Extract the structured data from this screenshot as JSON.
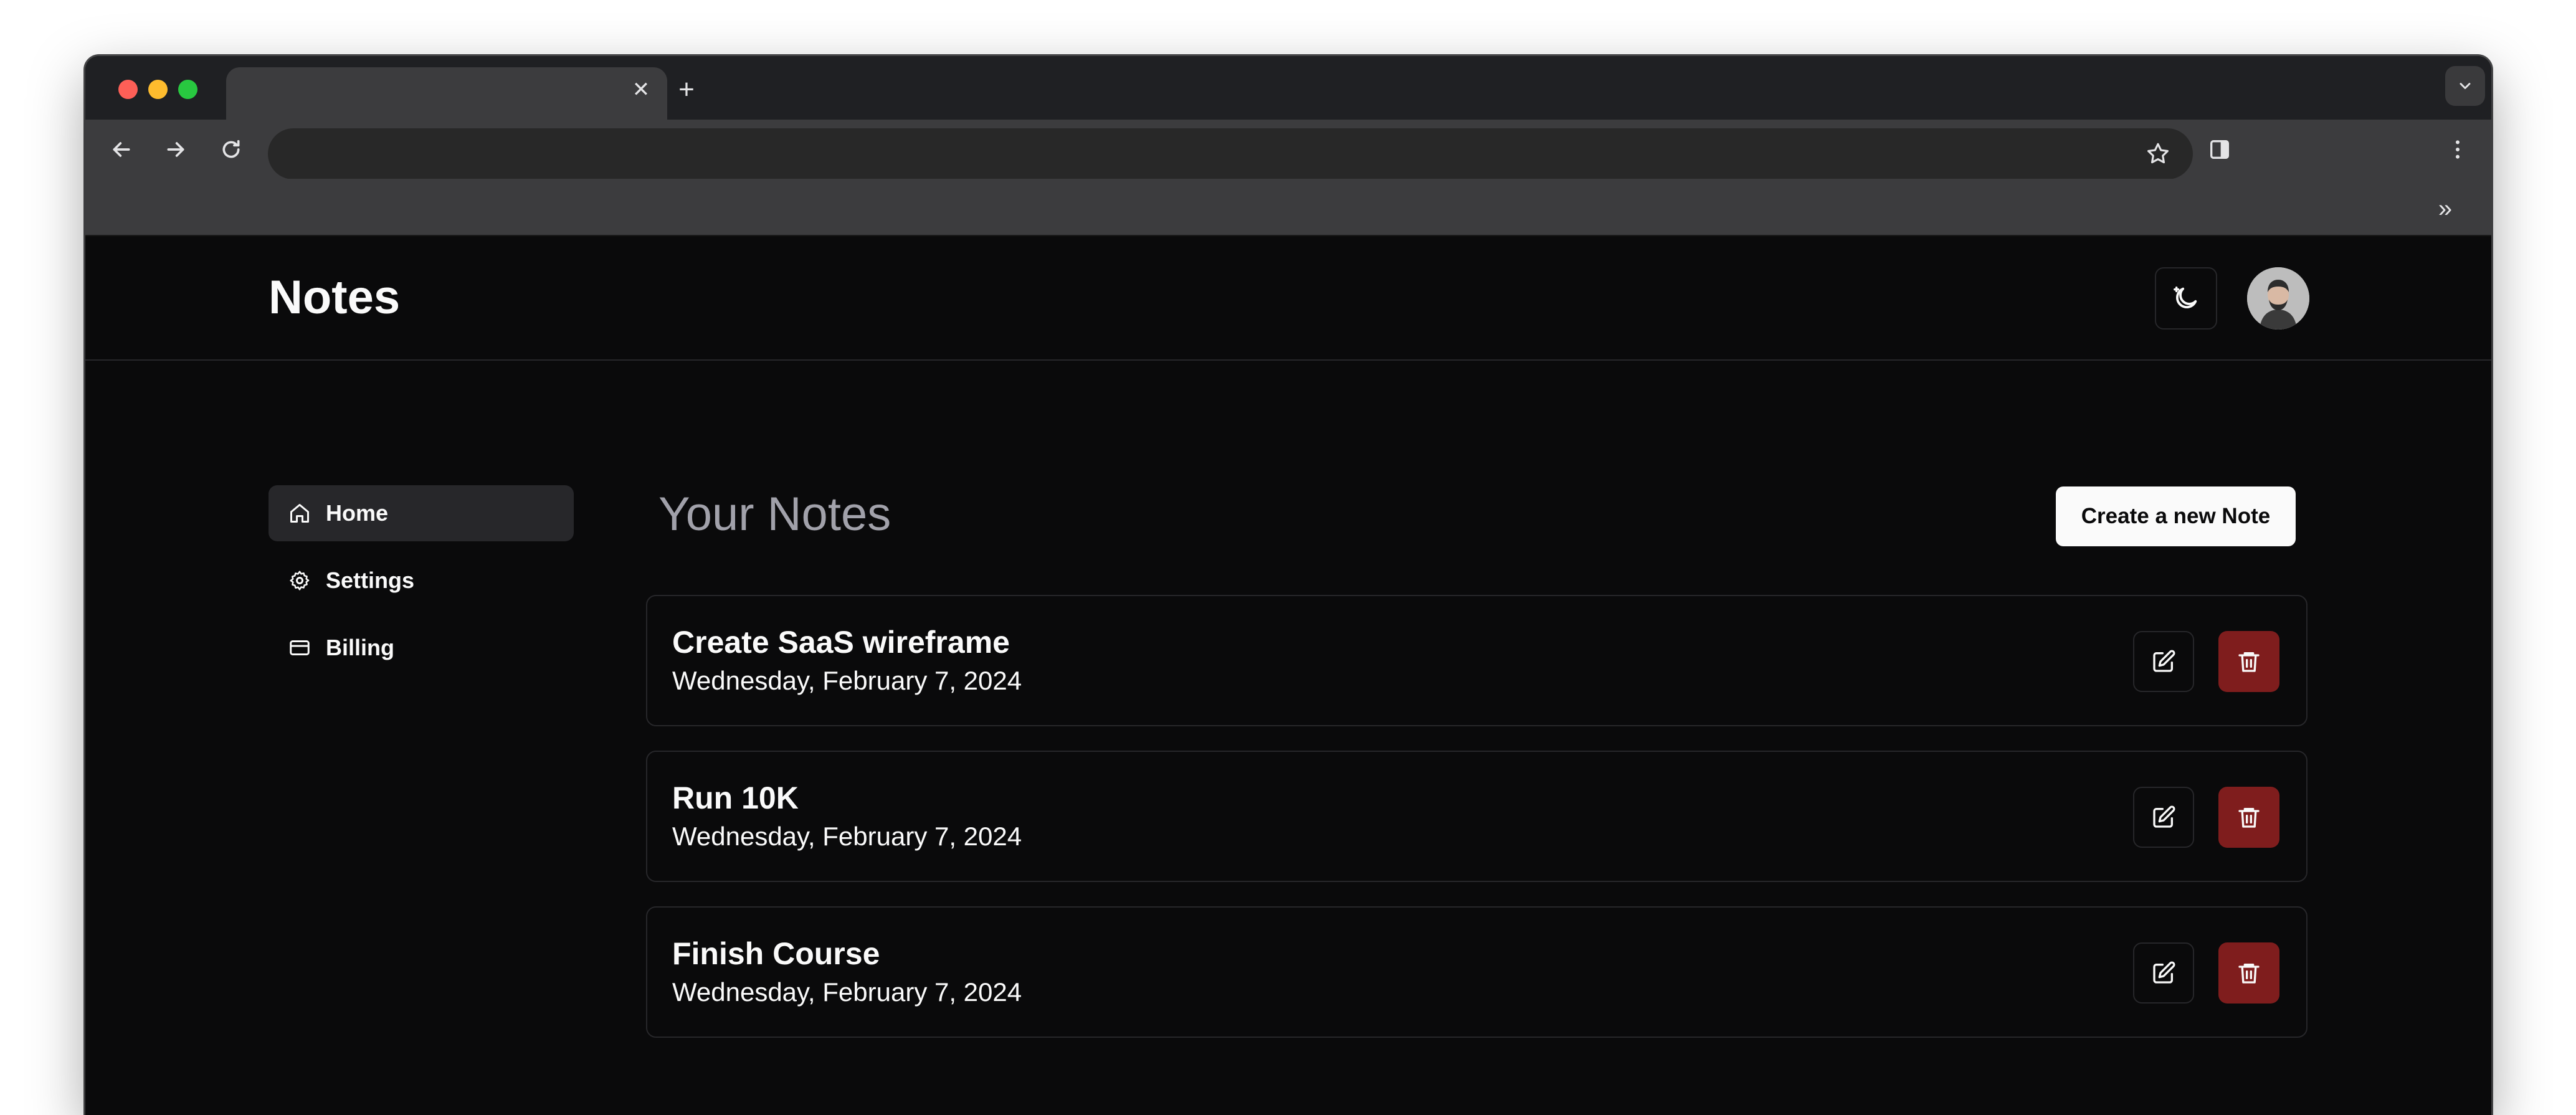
{
  "browser": {
    "tab_close_glyph": "✕",
    "new_tab_glyph": "+",
    "bookmarks_overflow_glyph": "»",
    "icons": [
      "back-icon",
      "forward-icon",
      "reload-icon",
      "star-icon",
      "side-panel-icon",
      "more-menu-icon",
      "tab-search-icon"
    ],
    "traffic_light_colors": [
      "#fe5f57",
      "#febc2e",
      "#28c840"
    ]
  },
  "header": {
    "brand": "Notes",
    "theme_toggle_icon": "moon-sun-icon"
  },
  "sidebar": {
    "items": [
      {
        "label": "Home",
        "icon": "home-icon",
        "active": true
      },
      {
        "label": "Settings",
        "icon": "gear-icon",
        "active": false
      },
      {
        "label": "Billing",
        "icon": "credit-card-icon",
        "active": false
      }
    ]
  },
  "main": {
    "title": "Your Notes",
    "create_button": "Create a new Note",
    "notes": [
      {
        "title": "Create SaaS wireframe",
        "date": "Wednesday, February 7, 2024"
      },
      {
        "title": "Run 10K",
        "date": "Wednesday, February 7, 2024"
      },
      {
        "title": "Finish Course",
        "date": "Wednesday, February 7, 2024"
      }
    ]
  },
  "colors": {
    "background": "#0a0a0b",
    "border": "#27272a",
    "delete_button": "#7f1d1d",
    "primary_button": "#fafafa"
  }
}
